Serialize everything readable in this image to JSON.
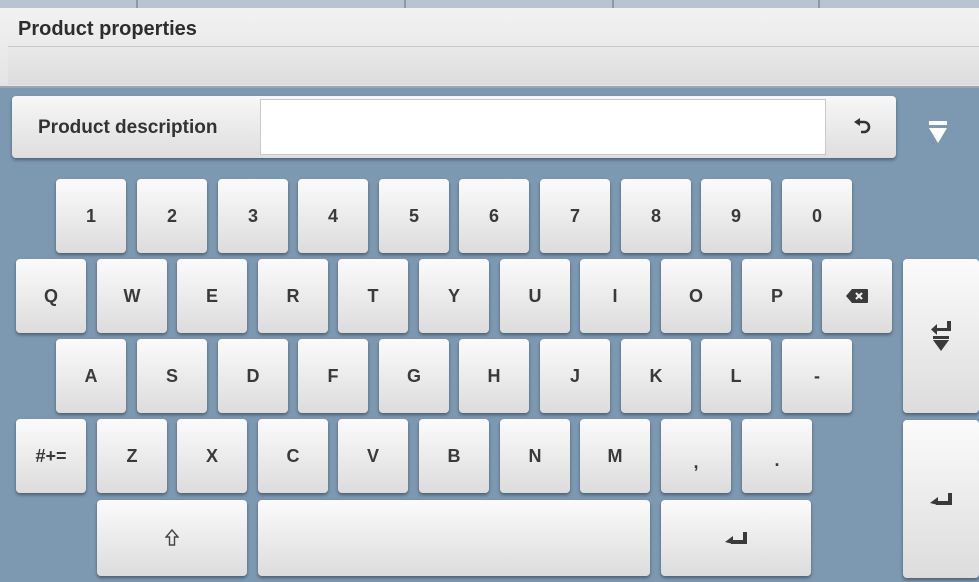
{
  "header": {
    "title": "Product properties"
  },
  "field": {
    "label": "Product description",
    "value": "",
    "undo_icon": "undo-icon",
    "collapse_icon": "collapse-triangle-icon"
  },
  "keyboard": {
    "row_numbers": [
      "1",
      "2",
      "3",
      "4",
      "5",
      "6",
      "7",
      "8",
      "9",
      "0"
    ],
    "row_q": [
      "Q",
      "W",
      "E",
      "R",
      "T",
      "Y",
      "U",
      "I",
      "O",
      "P"
    ],
    "row_a": [
      "A",
      "S",
      "D",
      "F",
      "G",
      "H",
      "J",
      "K",
      "L",
      "-"
    ],
    "row_z": [
      "Z",
      "X",
      "C",
      "V",
      "B",
      "N",
      "M",
      ",",
      "."
    ],
    "symbols_label": "#+=",
    "icons": {
      "backspace": "backspace-icon",
      "shift": "shift-icon",
      "space": "space-bar",
      "enter": "enter-icon",
      "tab_down": "tab-down-icon",
      "side_enter": "enter-icon"
    }
  },
  "colors": {
    "background": "#7d98b1",
    "key": "#eeeeee",
    "text": "#3a3a3a"
  }
}
